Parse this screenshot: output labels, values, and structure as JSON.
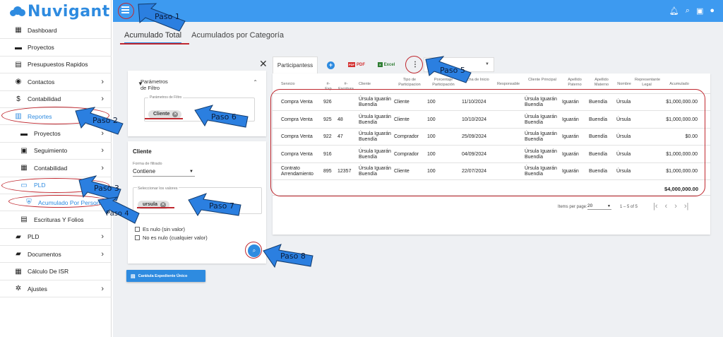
{
  "logo": {
    "text": "Nuvigant"
  },
  "sidebar": {
    "items": [
      {
        "label": "Dashboard",
        "icon": "dashboard-icon",
        "glyph": "▦",
        "chevron": ""
      },
      {
        "label": "Proyectos",
        "icon": "briefcase-icon",
        "glyph": "▬",
        "chevron": ""
      },
      {
        "label": "Presupuestos Rapidos",
        "icon": "document-icon",
        "glyph": "▤",
        "chevron": ""
      },
      {
        "label": "Contactos",
        "icon": "person-circle-icon",
        "glyph": "◉",
        "chevron": "›"
      },
      {
        "label": "Contabilidad",
        "icon": "dollar-icon",
        "glyph": "$",
        "chevron": "›"
      },
      {
        "label": "Reportes",
        "icon": "chart-icon",
        "glyph": "▥",
        "chevron": ""
      },
      {
        "label": "Proyectos",
        "icon": "briefcase-icon",
        "glyph": "▬",
        "chevron": "›"
      },
      {
        "label": "Seguimiento",
        "icon": "calendar-check-icon",
        "glyph": "▣",
        "chevron": "›"
      },
      {
        "label": "Contabilidad",
        "icon": "calculator-icon",
        "glyph": "▦",
        "chevron": "›"
      },
      {
        "label": "PLD",
        "icon": "id-card-icon",
        "glyph": "▭",
        "chevron": ""
      },
      {
        "label": "Acumulado Por Persona",
        "icon": "shield-icon",
        "glyph": "⛨",
        "chevron": ""
      },
      {
        "label": "Escrituras Y Folios",
        "icon": "document-icon",
        "glyph": "▤",
        "chevron": ""
      },
      {
        "label": "PLD",
        "icon": "folder-user-icon",
        "glyph": "▰",
        "chevron": "›"
      },
      {
        "label": "Documentos",
        "icon": "folder-icon",
        "glyph": "▰",
        "chevron": "›"
      },
      {
        "label": "Cálculo De ISR",
        "icon": "table-icon",
        "glyph": "▦",
        "chevron": ""
      },
      {
        "label": "Ajustes",
        "icon": "gear-icon",
        "glyph": "✲",
        "chevron": "›"
      }
    ]
  },
  "topbar": {
    "menu_icon": "menu-icon",
    "right_icons": [
      "bell-icon",
      "search-icon",
      "gallery-icon",
      "user-icon"
    ]
  },
  "tabs": [
    {
      "label": "Acumulado Total"
    },
    {
      "label": "Acumulados por Categoría"
    }
  ],
  "filter": {
    "title_line1": "Parámetros",
    "title_line2": "de Filtro",
    "field_label": "Parámetros de Filtro",
    "chip": "Cliente",
    "close": "✕"
  },
  "value_panel": {
    "title": "Cliente",
    "filter_mode_label": "Forma de filtrado",
    "filter_mode_value": "Contiene",
    "values_label": "Seleccionar los valores",
    "chip": "ursula",
    "null_label": "Es nulo (sin valor)",
    "not_null_label": "No es nulo (cualquier valor)"
  },
  "caratula_button": "Carátula Expediente Único",
  "table_toolbar": {
    "tab": "Participantess",
    "pdf": "PDF",
    "excel": "Excel"
  },
  "table": {
    "headers": [
      {
        "text": "Servicio"
      },
      {
        "text": "#-Exp"
      },
      {
        "text": "#-Escritura"
      },
      {
        "text": "Cliente"
      },
      {
        "text": "Tipo de Participacion"
      },
      {
        "text": "Porcentaje Participación"
      },
      {
        "text": "Fecha de Inicio"
      },
      {
        "text": "Responsable"
      },
      {
        "text": "Cliente Principal"
      },
      {
        "text": "Apellido Paterno"
      },
      {
        "text": "Apellido Materno"
      },
      {
        "text": "Nombre"
      },
      {
        "text": "Representante Legal"
      },
      {
        "text": "Acumulado"
      }
    ],
    "rows": [
      [
        "Compra Venta",
        "926",
        "",
        "Úrsula Iguarán Buendía",
        "Cliente",
        "100",
        "11/10/2024",
        "",
        "Úrsula Iguarán Buendía",
        "Iguarán",
        "Buendía",
        "Úrsula",
        "",
        "$1,000,000.00"
      ],
      [
        "Compra Venta",
        "925",
        "48",
        "Úrsula Iguarán Buendía",
        "Cliente",
        "100",
        "10/10/2024",
        "",
        "Úrsula Iguarán Buendía",
        "Iguarán",
        "Buendía",
        "Úrsula",
        "",
        "$1,000,000.00"
      ],
      [
        "Compra Venta",
        "922",
        "47",
        "Úrsula Iguarán Buendía",
        "Comprador",
        "100",
        "25/09/2024",
        "",
        "Úrsula Iguarán Buendía",
        "Iguarán",
        "Buendía",
        "Úrsula",
        "",
        "$0.00"
      ],
      [
        "Compra Venta",
        "916",
        "",
        "Úrsula Iguarán Buendía",
        "Comprador",
        "100",
        "04/09/2024",
        "",
        "Úrsula Iguarán Buendía",
        "Iguarán",
        "Buendía",
        "Úrsula",
        "",
        "$1,000,000.00"
      ],
      [
        "Contrato Arrendamiento",
        "895",
        "12357",
        "Úrsula Iguarán Buendía",
        "Cliente",
        "100",
        "22/07/2024",
        "",
        "Úrsula Iguarán Buendía",
        "Iguarán",
        "Buendía",
        "Úrsula",
        "",
        "$1,000,000.00"
      ]
    ],
    "total": "$4,000,000.00",
    "items_per_page_label": "Items per page:",
    "page_size": "20",
    "range": "1 – 5 of 5"
  },
  "annotations": {
    "steps": [
      "Paso 1",
      "Paso 2",
      "Paso 3",
      "Paso 4",
      "Paso 5",
      "Paso 6",
      "Paso 7",
      "Paso 8"
    ],
    "highlight_color": "#c0282f",
    "arrow_color": "#2b7fe0"
  }
}
